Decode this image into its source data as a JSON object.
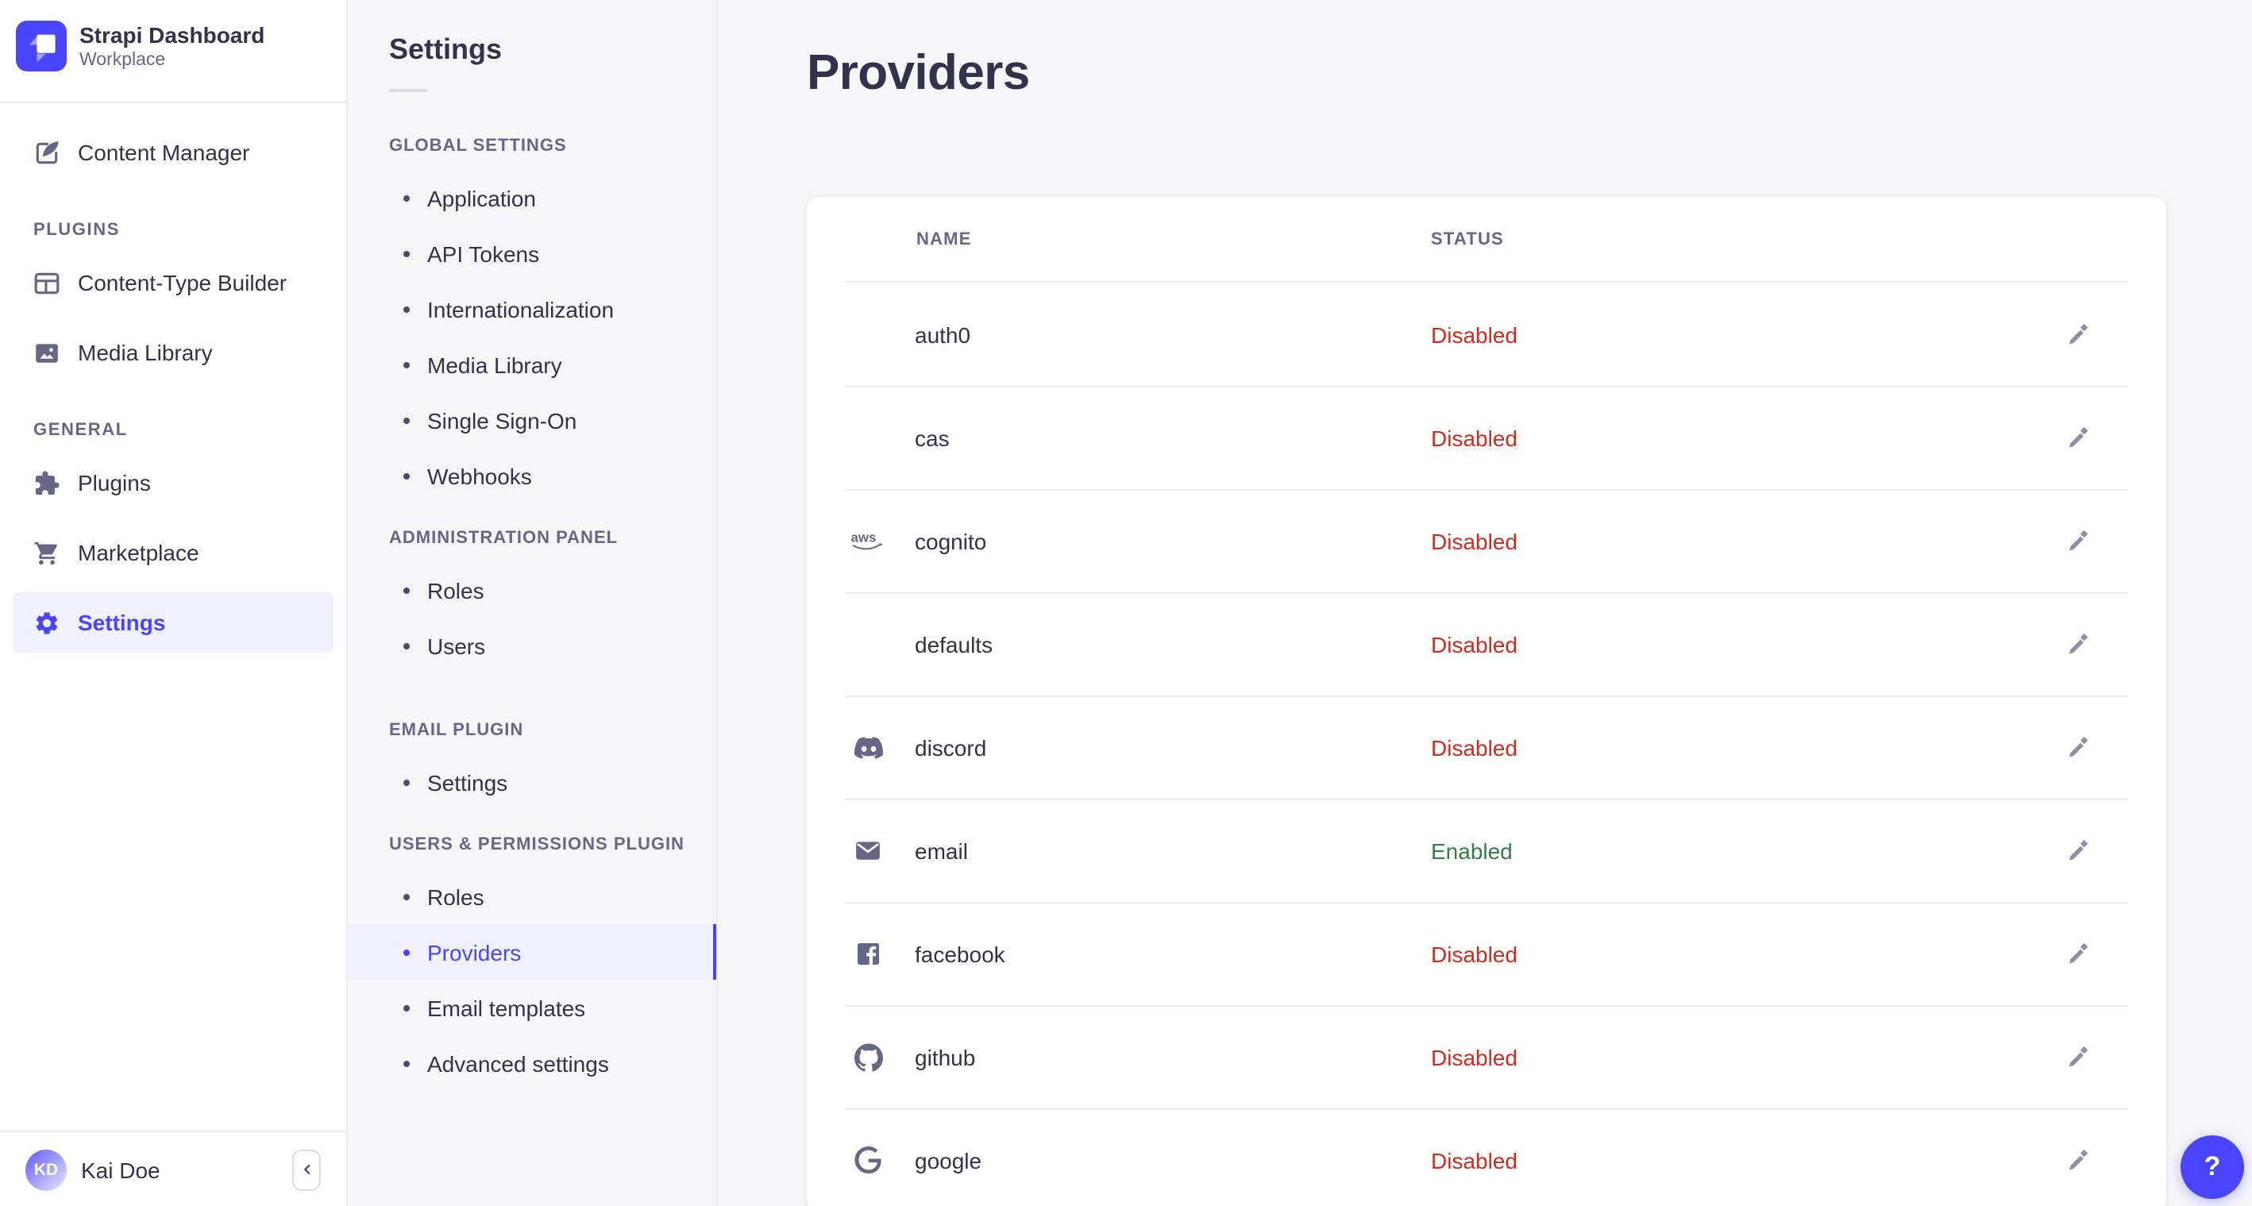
{
  "brand": {
    "title": "Strapi Dashboard",
    "subtitle": "Workplace"
  },
  "nav": {
    "content_manager_label": "Content Manager",
    "sections": [
      {
        "label": "PLUGINS",
        "items": [
          {
            "label": "Content-Type Builder",
            "icon": "content-type-builder-icon"
          },
          {
            "label": "Media Library",
            "icon": "media-library-icon"
          }
        ]
      },
      {
        "label": "GENERAL",
        "items": [
          {
            "label": "Plugins",
            "icon": "puzzle-icon"
          },
          {
            "label": "Marketplace",
            "icon": "cart-icon"
          },
          {
            "label": "Settings",
            "icon": "gear-icon",
            "active": true
          }
        ]
      }
    ],
    "user": {
      "initials": "KD",
      "name": "Kai Doe"
    }
  },
  "subnav": {
    "title": "Settings",
    "sections": [
      {
        "label": "GLOBAL SETTINGS",
        "items": [
          {
            "label": "Application"
          },
          {
            "label": "API Tokens"
          },
          {
            "label": "Internationalization"
          },
          {
            "label": "Media Library"
          },
          {
            "label": "Single Sign-On"
          },
          {
            "label": "Webhooks"
          }
        ]
      },
      {
        "label": "ADMINISTRATION PANEL",
        "items": [
          {
            "label": "Roles"
          },
          {
            "label": "Users"
          }
        ]
      },
      {
        "label": "EMAIL PLUGIN",
        "items": [
          {
            "label": "Settings"
          }
        ]
      },
      {
        "label": "USERS & PERMISSIONS PLUGIN",
        "items": [
          {
            "label": "Roles"
          },
          {
            "label": "Providers",
            "active": true
          },
          {
            "label": "Email templates"
          },
          {
            "label": "Advanced settings"
          }
        ]
      }
    ]
  },
  "page": {
    "title": "Providers",
    "table": {
      "columns": [
        "NAME",
        "STATUS"
      ],
      "rows": [
        {
          "name": "auth0",
          "icon": null,
          "status": "Disabled"
        },
        {
          "name": "cas",
          "icon": null,
          "status": "Disabled"
        },
        {
          "name": "cognito",
          "icon": "aws-icon",
          "status": "Disabled"
        },
        {
          "name": "defaults",
          "icon": null,
          "status": "Disabled"
        },
        {
          "name": "discord",
          "icon": "discord-icon",
          "status": "Disabled"
        },
        {
          "name": "email",
          "icon": "envelope-icon",
          "status": "Enabled"
        },
        {
          "name": "facebook",
          "icon": "facebook-icon",
          "status": "Disabled"
        },
        {
          "name": "github",
          "icon": "github-icon",
          "status": "Disabled"
        },
        {
          "name": "google",
          "icon": "google-icon",
          "status": "Disabled"
        }
      ]
    }
  },
  "help": {
    "label": "?"
  },
  "colors": {
    "accent": "#4945ff",
    "danger": "#d02b20",
    "success": "#328048",
    "text": "#32324d",
    "muted": "#666687"
  }
}
